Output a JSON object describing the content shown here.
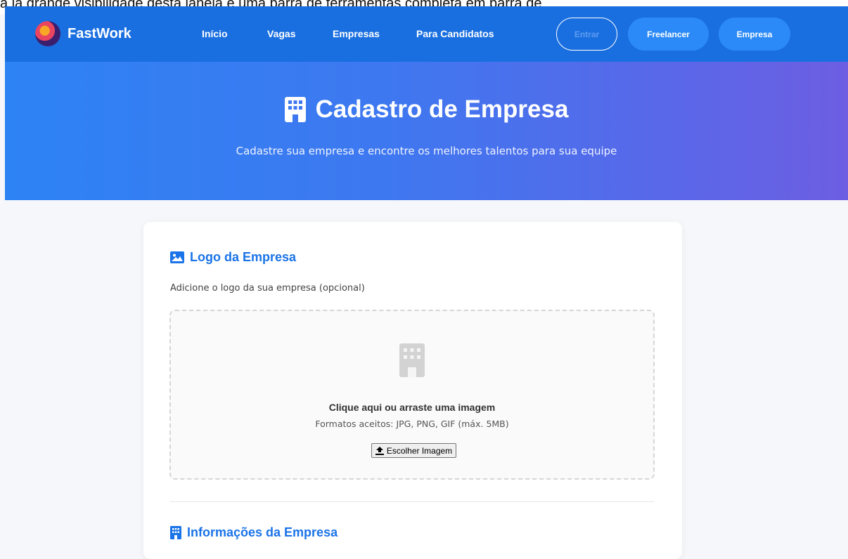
{
  "top_strip": {
    "text": "a la grande visibilidade desta janela e uma barra de ferramentas completa em barra de"
  },
  "nav": {
    "brand": "FastWork",
    "links": [
      "Início",
      "Vagas",
      "Empresas",
      "Para Candidatos"
    ],
    "login_label": "Entrar",
    "freelancer_label": "Freelancer",
    "company_label": "Empresa"
  },
  "hero": {
    "title": "Cadastro de Empresa",
    "subtitle": "Cadastre sua empresa e encontre os melhores talentos para sua equipe"
  },
  "logo_section": {
    "title": "Logo da Empresa",
    "description": "Adicione o logo da sua empresa (opcional)",
    "drop_title": "Clique aqui ou arraste uma imagem",
    "drop_formats": "Formatos aceitos: JPG, PNG, GIF (máx. 5MB)",
    "choose_button": "Escolher Imagem"
  },
  "info_section": {
    "title": "Informações da Empresa"
  },
  "colors": {
    "primary": "#1a73e8",
    "nav_bg": "#1a6fe0",
    "hero_start": "#2d83f4",
    "hero_end": "#6d5ee2"
  },
  "icons": {
    "logo_section": "image-icon",
    "info_section": "building-icon",
    "hero": "building-icon",
    "dropzone": "building-placeholder-icon",
    "upload": "upload-icon"
  }
}
